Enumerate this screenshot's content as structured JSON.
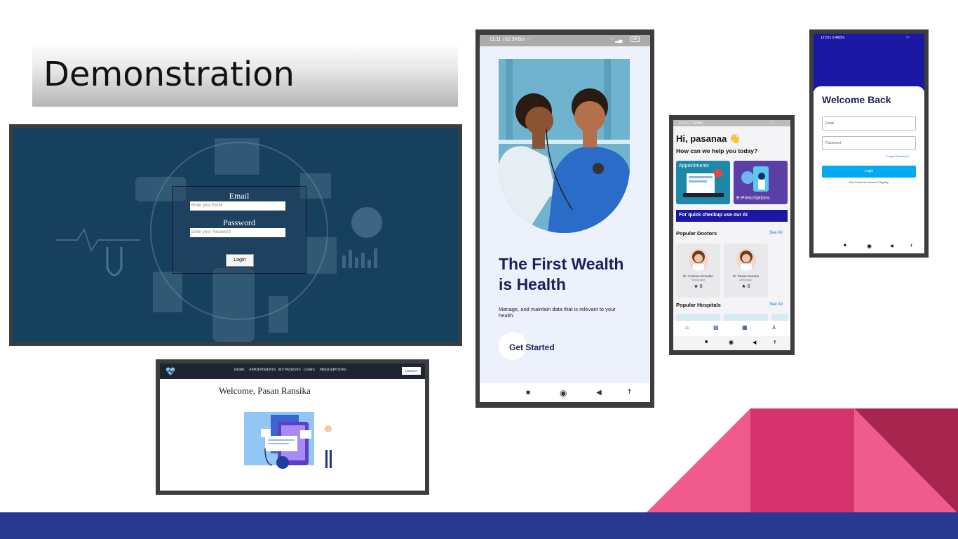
{
  "slide": {
    "title": "Demonstration",
    "colors": {
      "bottom_bar": "#2a3990",
      "triangle_left": "#ef5b8c",
      "triangle_mid": "#d6336c",
      "triangle_right": "#a82550"
    }
  },
  "web_login": {
    "email_label": "Email",
    "email_placeholder": "Enter your Email",
    "password_label": "Password",
    "password_placeholder": "Enter your Password",
    "login_button": "LogIn"
  },
  "web_dashboard": {
    "logo_icon": "heart-pulse-icon",
    "nav": [
      "HOME",
      "APPOINTMENTS",
      "MY PATIENTS",
      "CHATS",
      "PRESCRIPTIONS"
    ],
    "logout_button": "LOGOUT",
    "welcome": "Welcome, Pasan Ransika"
  },
  "onboarding": {
    "status_left": "11:11 | 62.9KB/s",
    "status_right": "56",
    "heading": "The First Wealth is Health",
    "description": "Manage, and maintain data that is relevant to your health.",
    "cta": "Get Started"
  },
  "home": {
    "status_left": "12:55 | 7.9KB/s",
    "greeting": "Hi, pasanaa 👋",
    "subheading": "How can we help you today?",
    "cards": [
      "Appointments",
      "E-Prescriptions"
    ],
    "ai_banner": "For quick checkup use our AI",
    "popular_doctors": "Popular Doctors",
    "see_all": "See All",
    "doctors": [
      {
        "name": "Dr. Cristiano Ronaldo",
        "specialty": "Neurologist",
        "rating": "0"
      },
      {
        "name": "Dr. Pasan Ransika",
        "specialty": "pathologist",
        "rating": "0"
      }
    ],
    "popular_hospitals": "Popular Hospitals",
    "tabs": [
      "home-icon",
      "chat-icon",
      "calendar-icon",
      "profile-icon"
    ]
  },
  "login_app": {
    "status_left": "12:53 | 0.4KB/s",
    "title": "Welcome Back",
    "email_placeholder": "Email",
    "password_placeholder": "Password",
    "forgot": "Forgot Password?",
    "login_button": "Login",
    "signup_prompt": "Don't have an account? SignUp"
  },
  "android_nav": {
    "recents": "■",
    "home": "◉",
    "back": "◀",
    "accessibility": "☨"
  }
}
